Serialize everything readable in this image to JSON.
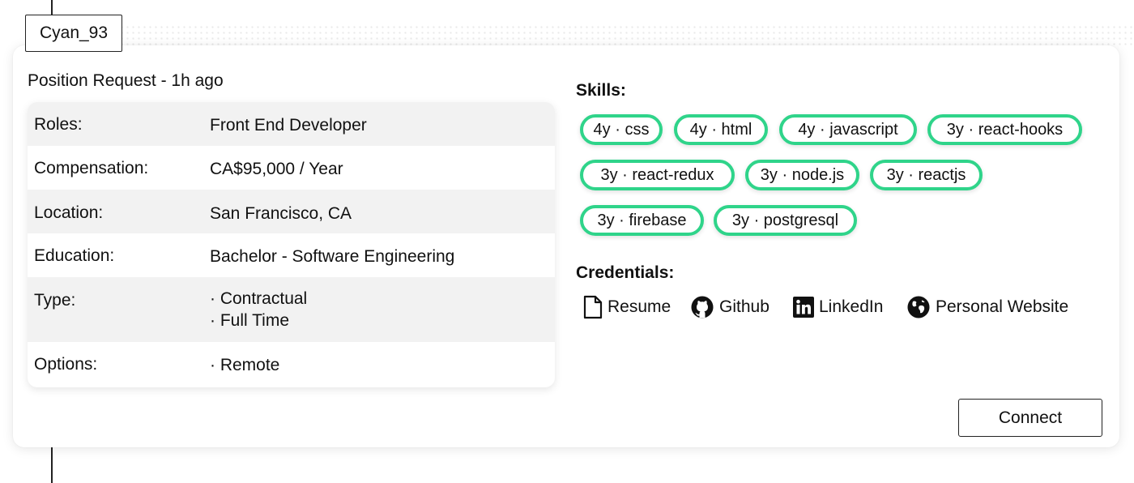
{
  "user": {
    "handle": "Cyan_93"
  },
  "request": {
    "heading": "Position Request - 1h ago"
  },
  "details": [
    {
      "label": "Roles:",
      "values": [
        "Front End Developer"
      ]
    },
    {
      "label": "Compensation:",
      "values": [
        "CA$95,000 / Year"
      ]
    },
    {
      "label": "Location:",
      "values": [
        "San Francisco, CA"
      ]
    },
    {
      "label": "Education:",
      "values": [
        "Bachelor - Software Engineering"
      ]
    },
    {
      "label": "Type:",
      "values": [
        "· Contractual",
        "· Full Time"
      ]
    },
    {
      "label": "Options:",
      "values": [
        "· Remote"
      ]
    }
  ],
  "skills": {
    "title": "Skills:",
    "items": [
      "4y · css",
      "4y · html",
      "4y · javascript",
      "3y · react-hooks",
      "3y · react-redux",
      "3y · node.js",
      "3y · reactjs",
      "3y · firebase",
      "3y · postgresql"
    ]
  },
  "credentials": {
    "title": "Credentials:",
    "items": [
      {
        "label": "Resume",
        "icon": "document-icon"
      },
      {
        "label": "Github",
        "icon": "github-icon"
      },
      {
        "label": "LinkedIn",
        "icon": "linkedin-icon"
      },
      {
        "label": "Personal Website",
        "icon": "globe-icon"
      }
    ]
  },
  "actions": {
    "connect_label": "Connect"
  },
  "colors": {
    "chip_border": "#2fd48a",
    "row_shade": "#f2f2f2"
  }
}
